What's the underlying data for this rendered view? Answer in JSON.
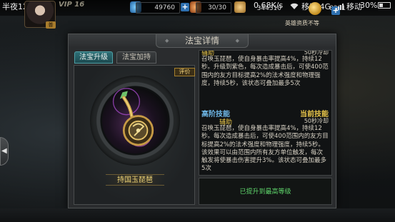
{
  "status_bar": {
    "time": "半夜12:59",
    "network_speed": "0.68K/s",
    "carrier": "移动 4G",
    "carrier2": "移动",
    "battery": "30%"
  },
  "hud": {
    "vip": "VIP 16",
    "avatar_badge": "普",
    "stamina": "49760",
    "energy": "30/30",
    "coins": "344310",
    "gold": "8221",
    "hint": "英雄资质不等"
  },
  "panel": {
    "title": "法宝详情",
    "tabs": [
      {
        "label": "法宝升级",
        "active": true
      },
      {
        "label": "法宝加持",
        "active": false
      }
    ],
    "rate_button": "评价",
    "item_name": "持国玉琵琶",
    "info": {
      "current_type": "辅助",
      "current_cooldown": "50秒冷却",
      "current_desc": "召唤玉琵琶，使自身暴击率提高4%，持续12秒。升级到紫色，每次造成暴击后，可使400范围内的友方目标提高2%的法术强度和物理强度，持续5秒，该状态可叠加最多5次",
      "advanced_title": "高阶技能",
      "current_title": "当前技能",
      "advanced_type": "辅助",
      "advanced_cooldown": "50秒冷却",
      "advanced_desc": "召唤玉琵琶，使自身暴击率提高4%，持续12秒。每次造成暴击后，可使400范围内的友方目标提高2%的法术强度和物理强度，持续5秒。该效果可以由范围内所有友方单位触发，每次触发将使暴击伤害提升3%。该状态可叠加最多5次",
      "max_level": "已提升到最高等级"
    }
  },
  "colors": {
    "accent_gold": "#e8c54a",
    "accent_blue": "#6fb8e8",
    "accent_green": "#5fd66b",
    "tab_active": "#2e6f76"
  },
  "icons": [
    "stamina-icon",
    "energy-icon",
    "coin-icon",
    "gold-icon",
    "wifi-icon",
    "signal-icon",
    "battery-icon",
    "pipa-artifact-icon",
    "arrow-left-icon"
  ]
}
